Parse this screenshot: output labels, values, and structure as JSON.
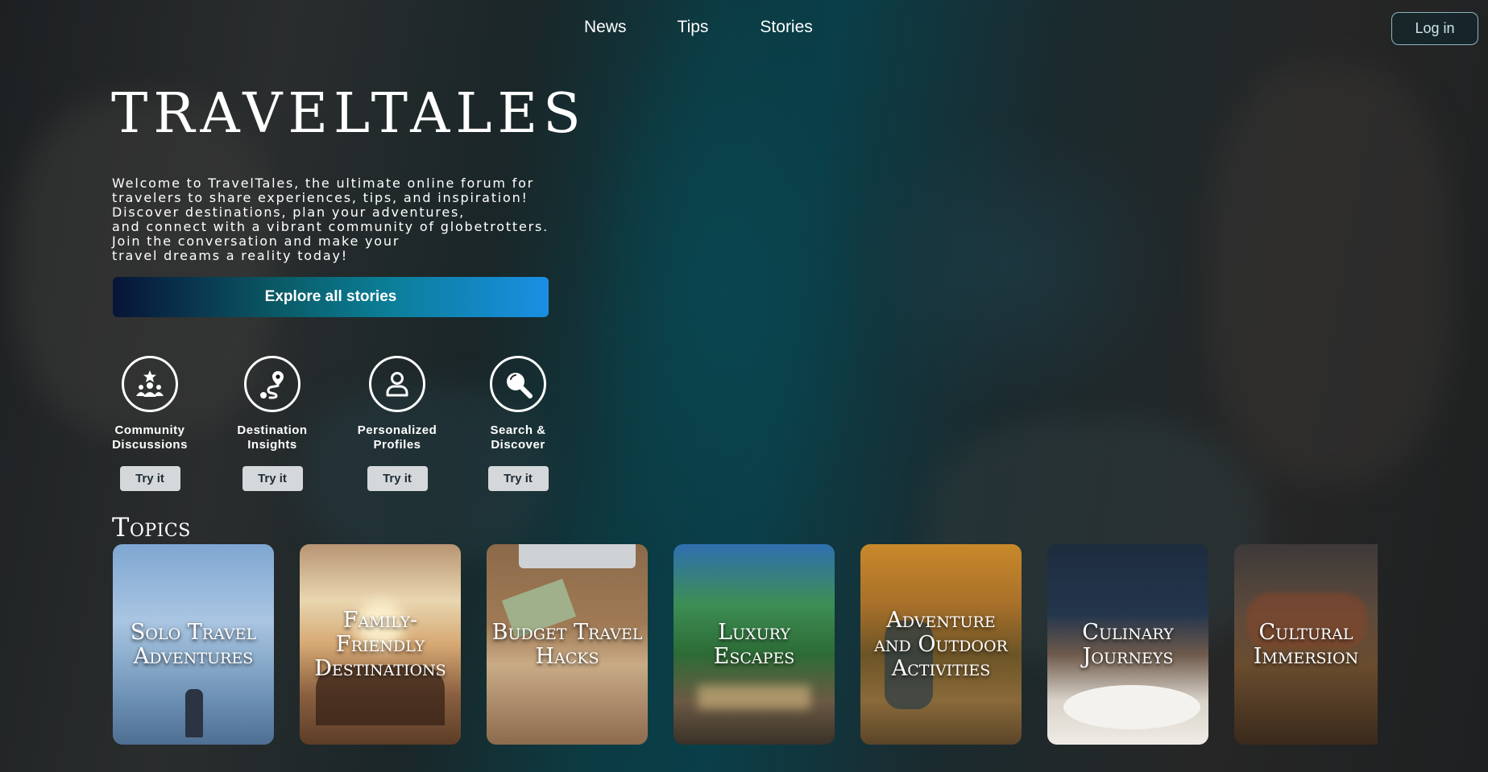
{
  "nav": {
    "links": [
      "News",
      "Tips",
      "Stories"
    ],
    "login_label": "Log in"
  },
  "hero": {
    "brand": "TRAVELTALES",
    "intro": "Welcome to TravelTales, the ultimate online forum for\ntravelers to share experiences, tips, and inspiration!\nDiscover destinations, plan your adventures,\nand connect with a vibrant community of globetrotters.\nJoin the conversation and make your\ntravel dreams a reality today!",
    "cta_label": "Explore all stories"
  },
  "features": [
    {
      "label": "Community\nDiscussions",
      "icon": "community-star-icon",
      "try_label": "Try it"
    },
    {
      "label": "Destination\nInsights",
      "icon": "route-pin-icon",
      "try_label": "Try it"
    },
    {
      "label": "Personalized\nProfiles",
      "icon": "user-profile-icon",
      "try_label": "Try it"
    },
    {
      "label": "Search &\nDiscover",
      "icon": "magnifier-icon",
      "try_label": "Try it"
    }
  ],
  "topics": {
    "title": "Topics",
    "cards": [
      {
        "title": "Solo Travel Adventures",
        "image": "hiker-on-mountain"
      },
      {
        "title": "Family-Friendly Destinations",
        "image": "family-at-sunset"
      },
      {
        "title": "Budget Travel Hacks",
        "image": "cash-and-laptop"
      },
      {
        "title": "Luxury Escapes",
        "image": "palm-resort"
      },
      {
        "title": "Adventure and Outdoor Activities",
        "image": "mountain-biking"
      },
      {
        "title": "Culinary Journeys",
        "image": "chef-plating"
      },
      {
        "title": "Cultural Immersion",
        "image": "people-in-traditional-dress"
      }
    ]
  },
  "colors": {
    "cta_start": "#081437",
    "cta_end": "#1a8fe3",
    "button_gray": "#d4d8da",
    "water": "#0a3e48"
  }
}
